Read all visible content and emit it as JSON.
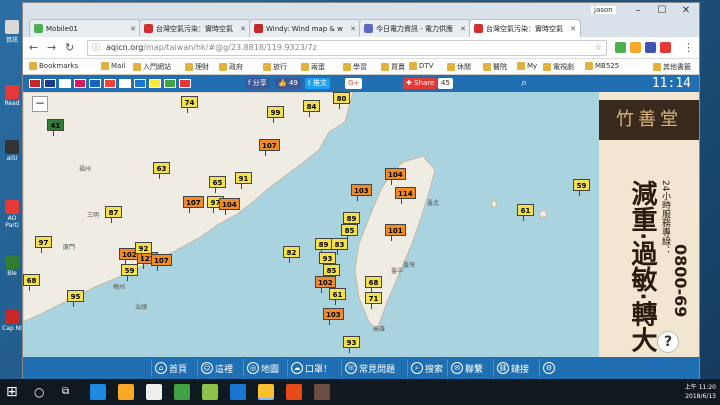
{
  "desktop": {
    "icons": [
      "資訊",
      "Read",
      "aiSi",
      "AO Parti",
      "Ble",
      "Cap NI"
    ]
  },
  "browser": {
    "tabs": [
      {
        "title": "Mobile01",
        "color": "#4caf50",
        "active": false
      },
      {
        "title": "台灣空氣污染：實時空氣",
        "color": "#d32f2f",
        "active": false
      },
      {
        "title": "Windy: Wind map & w",
        "color": "#c62828",
        "active": false
      },
      {
        "title": "今日電力資訊 - 電力供應",
        "color": "#5c6bc0",
        "active": false
      },
      {
        "title": "台灣空氣污染：實時空氣",
        "color": "#d32f2f",
        "active": true
      }
    ],
    "user_label": "jason",
    "url_host": "aqicn.org",
    "url_path": "/map/taiwan/hk/#@g/23.8818/119.9323/7z",
    "bookmarks": [
      "Bookmarks",
      "Mail",
      "入門網站",
      "理財",
      "政府",
      "旅行",
      "兩蛋",
      "學習",
      "買賣",
      "DTV",
      "休閒",
      "醫院",
      "My",
      "電視劇",
      "MB525"
    ],
    "other_bookmarks": "其他書籤"
  },
  "site": {
    "share_fb": "分享",
    "like_count": "49",
    "share_line": "推文",
    "gplus": "G+",
    "share_label": "Share",
    "share_count": "45",
    "clock": "11:14",
    "flags": [
      "#c62828",
      "#1e3a8a",
      "#ffffff",
      "#d81b60",
      "#1565c0",
      "#f44336",
      "#ffffff",
      "#1976d2",
      "#ffeb3b",
      "#43a047",
      "#e53935"
    ],
    "zoom_label": "−",
    "help_label": "?",
    "ad": {
      "title": "竹善堂",
      "big": "減重‧過敏‧轉大",
      "small": "24小時服務專線：",
      "phone": "0800-69"
    },
    "bottom_nav": [
      "首頁",
      "這裡",
      "地圖",
      "口罩！",
      "常見問題",
      "搜索",
      "聯繫",
      "鏈接"
    ]
  },
  "map": {
    "places": [
      "福州",
      "廈門",
      "汕頭",
      "臺北",
      "臺中",
      "高雄",
      "臺灣",
      "梅州",
      "龍岩",
      "三明"
    ],
    "markers": [
      {
        "v": "41",
        "c": "#2e7d32"
      },
      {
        "v": "74",
        "c": "#f4e04d"
      },
      {
        "v": "99",
        "c": "#f4e04d"
      },
      {
        "v": "84",
        "c": "#f4e04d"
      },
      {
        "v": "80",
        "c": "#f4e04d"
      },
      {
        "v": "107",
        "c": "#f08a24"
      },
      {
        "v": "63",
        "c": "#f4e04d"
      },
      {
        "v": "65",
        "c": "#f4e04d"
      },
      {
        "v": "91",
        "c": "#f4e04d"
      },
      {
        "v": "107",
        "c": "#f08a24"
      },
      {
        "v": "97",
        "c": "#f4e04d"
      },
      {
        "v": "104",
        "c": "#f08a24"
      },
      {
        "v": "87",
        "c": "#f4e04d"
      },
      {
        "v": "97",
        "c": "#f4e04d"
      },
      {
        "v": "102",
        "c": "#f08a24"
      },
      {
        "v": "127",
        "c": "#f08a24"
      },
      {
        "v": "92",
        "c": "#f4e04d"
      },
      {
        "v": "59",
        "c": "#f4e04d"
      },
      {
        "v": "107",
        "c": "#f08a24"
      },
      {
        "v": "68",
        "c": "#f4e04d"
      },
      {
        "v": "95",
        "c": "#f4e04d"
      },
      {
        "v": "103",
        "c": "#f08a24"
      },
      {
        "v": "104",
        "c": "#f08a24"
      },
      {
        "v": "114",
        "c": "#f08a24"
      },
      {
        "v": "89",
        "c": "#f4e04d"
      },
      {
        "v": "85",
        "c": "#f4e04d"
      },
      {
        "v": "101",
        "c": "#f08a24"
      },
      {
        "v": "82",
        "c": "#f4e04d"
      },
      {
        "v": "89",
        "c": "#f4e04d"
      },
      {
        "v": "83",
        "c": "#f4e04d"
      },
      {
        "v": "93",
        "c": "#f4e04d"
      },
      {
        "v": "85",
        "c": "#f4e04d"
      },
      {
        "v": "68",
        "c": "#f4e04d"
      },
      {
        "v": "102",
        "c": "#f08a24"
      },
      {
        "v": "61",
        "c": "#f4e04d"
      },
      {
        "v": "71",
        "c": "#f4e04d"
      },
      {
        "v": "103",
        "c": "#f08a24"
      },
      {
        "v": "93",
        "c": "#f4e04d"
      },
      {
        "v": "61",
        "c": "#f4e04d"
      },
      {
        "v": "59",
        "c": "#f4e04d"
      }
    ]
  },
  "taskbar": {
    "time": "上午 11:20",
    "date": "2018/6/13"
  }
}
